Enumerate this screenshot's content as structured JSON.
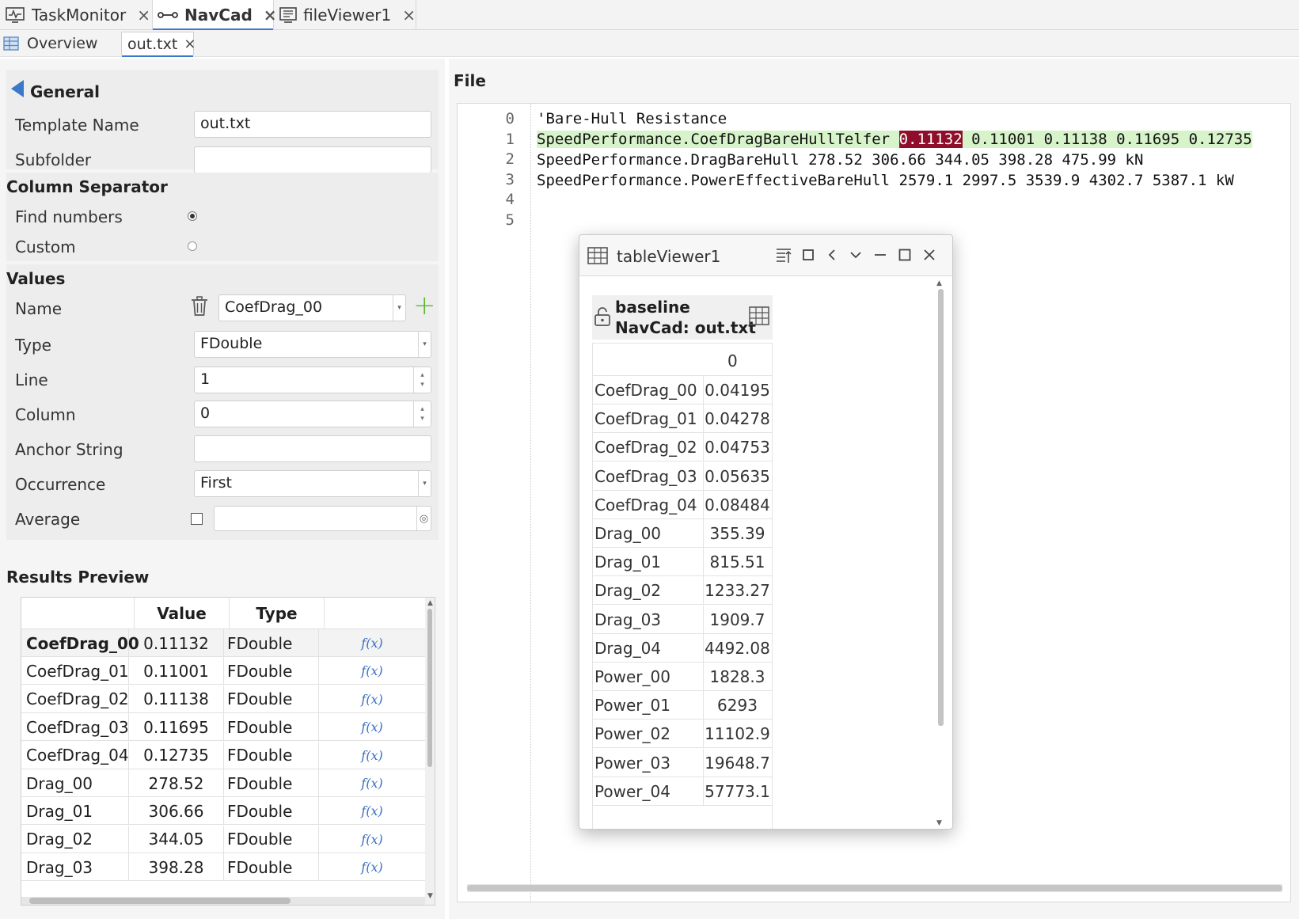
{
  "tabs": [
    {
      "label": "TaskMonitor",
      "icon": "monitor-icon",
      "active": false
    },
    {
      "label": "NavCad",
      "icon": "link-icon",
      "active": true
    },
    {
      "label": "fileViewer1",
      "icon": "document-icon",
      "active": false
    }
  ],
  "subtabs": [
    {
      "label": "Overview",
      "icon": "table-icon"
    },
    {
      "label": "out.txt",
      "active": true
    }
  ],
  "general": {
    "title": "General",
    "template_name_label": "Template Name",
    "template_name_value": "out.txt",
    "subfolder_label": "Subfolder",
    "subfolder_value": ""
  },
  "column_separator": {
    "title": "Column Separator",
    "find_numbers_label": "Find numbers",
    "custom_label": "Custom",
    "selected": "Find numbers"
  },
  "values": {
    "title": "Values",
    "name_label": "Name",
    "name_value": "CoefDrag_00",
    "type_label": "Type",
    "type_value": "FDouble",
    "line_label": "Line",
    "line_value": "1",
    "column_label": "Column",
    "column_value": "0",
    "anchor_label": "Anchor String",
    "anchor_value": "",
    "occurrence_label": "Occurrence",
    "occurrence_value": "First",
    "average_label": "Average",
    "average_value": ""
  },
  "results": {
    "title": "Results Preview",
    "headers": [
      "",
      "Value",
      "Type",
      ""
    ],
    "fx_label": "f(x)",
    "rows": [
      {
        "name": "CoefDrag_00",
        "value": "0.11132",
        "type": "FDouble"
      },
      {
        "name": "CoefDrag_01",
        "value": "0.11001",
        "type": "FDouble"
      },
      {
        "name": "CoefDrag_02",
        "value": "0.11138",
        "type": "FDouble"
      },
      {
        "name": "CoefDrag_03",
        "value": "0.11695",
        "type": "FDouble"
      },
      {
        "name": "CoefDrag_04",
        "value": "0.12735",
        "type": "FDouble"
      },
      {
        "name": "Drag_00",
        "value": "278.52",
        "type": "FDouble"
      },
      {
        "name": "Drag_01",
        "value": "306.66",
        "type": "FDouble"
      },
      {
        "name": "Drag_02",
        "value": "344.05",
        "type": "FDouble"
      },
      {
        "name": "Drag_03",
        "value": "398.28",
        "type": "FDouble"
      }
    ]
  },
  "file": {
    "title": "File",
    "line_numbers": [
      "0",
      "1",
      "2",
      "3",
      "4",
      "5"
    ],
    "lines": [
      "'Bare-Hull Resistance",
      "",
      "SpeedPerformance.DragBareHull 278.52 306.66 344.05 398.28 475.99 kN",
      "SpeedPerformance.PowerEffectiveBareHull 2579.1 2997.5 3539.9 4302.7 5387.1 kW",
      "",
      ""
    ],
    "line1_prefix": "SpeedPerformance.CoefDragBareHullTelfer ",
    "line1_selected": "0.11132",
    "line1_suffix": " 0.11001 0.11138 0.11695 0.12735"
  },
  "table_viewer": {
    "title": "tableViewer1",
    "header_line1": "baseline",
    "header_line2": "NavCad: out.txt",
    "column_header": "0",
    "rows": [
      {
        "name": "CoefDrag_00",
        "value": "0.04195"
      },
      {
        "name": "CoefDrag_01",
        "value": "0.04278"
      },
      {
        "name": "CoefDrag_02",
        "value": "0.04753"
      },
      {
        "name": "CoefDrag_03",
        "value": "0.05635"
      },
      {
        "name": "CoefDrag_04",
        "value": "0.08484"
      },
      {
        "name": "Drag_00",
        "value": "355.39"
      },
      {
        "name": "Drag_01",
        "value": "815.51"
      },
      {
        "name": "Drag_02",
        "value": "1233.27"
      },
      {
        "name": "Drag_03",
        "value": "1909.7"
      },
      {
        "name": "Drag_04",
        "value": "4492.08"
      },
      {
        "name": "Power_00",
        "value": "1828.3"
      },
      {
        "name": "Power_01",
        "value": "6293"
      },
      {
        "name": "Power_02",
        "value": "11102.9"
      },
      {
        "name": "Power_03",
        "value": "19648.7"
      },
      {
        "name": "Power_04",
        "value": "57773.1"
      }
    ]
  },
  "colors": {
    "accent": "#3a78c9",
    "add": "#5cb531",
    "highlight_line": "#d6f3c9",
    "selection": "#8f0f2a"
  }
}
